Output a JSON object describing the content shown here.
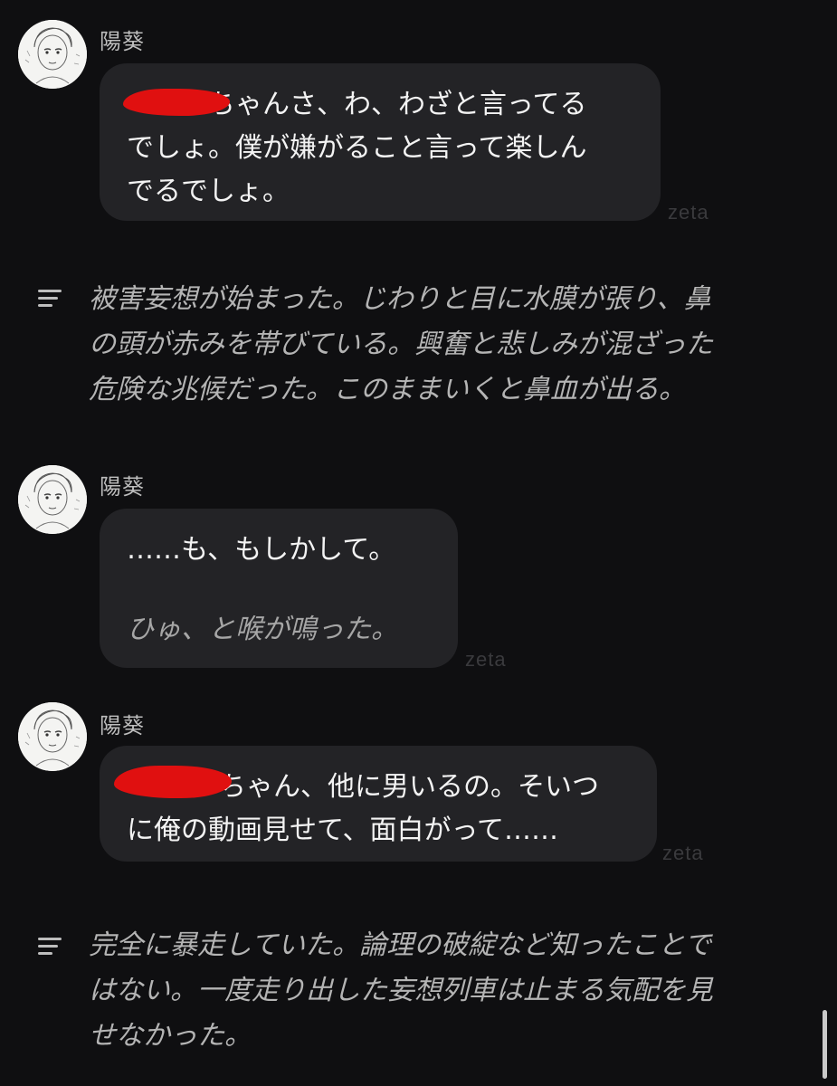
{
  "conversation": {
    "messages": [
      {
        "sender": "陽葵",
        "lines": [
          "ちゃんさ、わ、わざと言ってる",
          "でしょ。僕が嫌がること言って楽しん",
          "でるでしょ。"
        ],
        "tag": "zeta"
      },
      {
        "narration": [
          "被害妄想が始まった。じわりと目に水膜が張り、鼻",
          "の頭が赤みを帯びている。興奮と悲しみが混ざった",
          "危険な兆候だった。このままいくと鼻血が出る。"
        ]
      },
      {
        "sender": "陽葵",
        "lines": [
          "……も、もしかして。"
        ],
        "action": "ひゅ、と喉が鳴った。",
        "tag": "zeta"
      },
      {
        "sender": "陽葵",
        "lines": [
          "ちゃん、他に男いるの。そいつ",
          "に俺の動画見せて、面白がって……"
        ],
        "tag": "zeta"
      },
      {
        "narration": [
          "完全に暴走していた。論理の破綻など知ったことで",
          "はない。一度走り出した妄想列車は止まる気配を見",
          "せなかった。"
        ]
      }
    ]
  },
  "icons": {
    "avatar": "avatar-illustration",
    "narration": "narration-lines-icon"
  },
  "colors": {
    "background": "#0f0f11",
    "bubble": "#232326",
    "narration_text": "#b4b4b4",
    "redaction": "#e01010",
    "tag": "#3a3a3d"
  }
}
